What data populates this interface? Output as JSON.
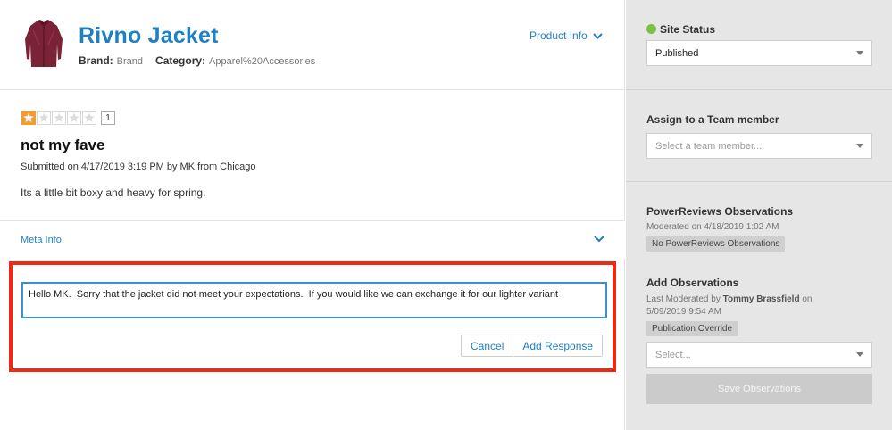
{
  "product": {
    "title": "Rivno Jacket",
    "brand_label": "Brand:",
    "brand_value": "Brand",
    "category_label": "Category:",
    "category_value": "Apparel%20Accessories",
    "info_link": "Product Info"
  },
  "review": {
    "rating": 1,
    "rating_max": 5,
    "rating_count": "1",
    "title": "not my fave",
    "submitted": "Submitted on 4/17/2019 3:19 PM by MK from Chicago",
    "body": "Its a little bit boxy and heavy for spring.",
    "meta_link": "Meta Info"
  },
  "response": {
    "text": "Hello MK.  Sorry that the jacket did not meet your expectations.  If you would like we can exchange it for our lighter variant",
    "cancel_label": "Cancel",
    "add_label": "Add Response"
  },
  "sidebar": {
    "status": {
      "label": "Site Status",
      "value": "Published",
      "dot_color": "#7ac143"
    },
    "assign": {
      "label": "Assign to a Team member",
      "placeholder": "Select a team member..."
    },
    "observations": {
      "label": "PowerReviews Observations",
      "moderated": "Moderated on 4/18/2019 1:02 AM",
      "tag": "No PowerReviews Observations"
    },
    "add_observations": {
      "label": "Add Observations",
      "last_moderated_prefix": "Last Moderated by",
      "moderator": "Tommy Brassfield",
      "on_word": "on",
      "date": "5/09/2019 9:54 AM",
      "tag": "Publication Override",
      "placeholder": "Select...",
      "save_label": "Save Observations"
    }
  },
  "colors": {
    "accent": "#1f7fc3",
    "highlight_border": "#ee2a14",
    "star_on": "#f39c33"
  }
}
